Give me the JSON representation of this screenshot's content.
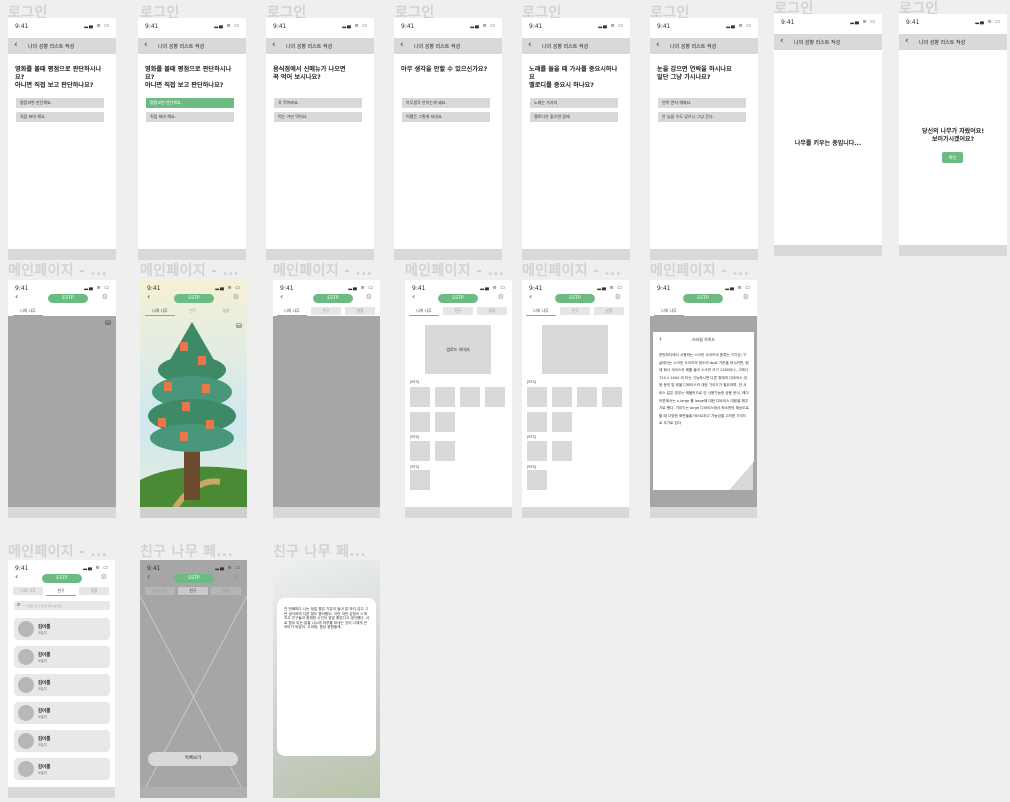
{
  "labels": {
    "login": "로그인",
    "main_page": "메인페이지 - ...",
    "friend_tree": "친구 나무 페..."
  },
  "status": {
    "time": "9:41",
    "icons": "▂▄ ≋ ▭"
  },
  "header": {
    "back": "‹",
    "title": "나의 성향 리스트 작성"
  },
  "questions": [
    {
      "q": "영화를 볼때 평점으로 판단하시나요?\n아니면 직접 보고 판단하나요?",
      "options": [
        "평점보면 판단해요.",
        "직접 봐야 해요."
      ],
      "selected": -1
    },
    {
      "q": "영화를 볼때 평점으로 판단하시나요?\n아니면 직접 보고 판단하나요?",
      "options": [
        "평점보면 판단해요.",
        "직접 봐야 해요."
      ],
      "selected": 0
    },
    {
      "q": "음식점에서 신메뉴가 나오면\n꼭 먹어 보시나요?",
      "options": [
        "꼭 먹어봐요.",
        "먹는 거만 먹어요."
      ],
      "selected": -1
    },
    {
      "q": "아무 생각을 안할 수 있으신가요?",
      "options": [
        "아무생각 안하는게 돼요.",
        "어쨌든 그렇게 되네요."
      ],
      "selected": -1
    },
    {
      "q": "노래를 들을 때 가사를 중요시하나요\n멜로디를 중요시 하나요?",
      "options": [
        "노래는 가사지",
        "멜로디가 좋으면 맘에"
      ],
      "selected": -1
    },
    {
      "q": "눈을 감으면 연락을 하시나요\n일단 그냥 가시나요?",
      "options": [
        "연락 먼저 해봐요.",
        "안 늦을 수도 있으니 그냥 간다."
      ],
      "selected": -1
    }
  ],
  "growing": {
    "message": "나무를 키우는 중입니다..."
  },
  "complete": {
    "message": "당신의 나무가 자랐어요!\n보러가시겠어요?",
    "button": "확인"
  },
  "main": {
    "badge": "ESTP",
    "chevron": "‹",
    "gear": "⚙",
    "tabs": [
      "나의 나무",
      "친구",
      "설정"
    ],
    "preview_label": "업로드 이미지",
    "section_label": "[RTS]",
    "doc_title": "스타일 가이드",
    "doc_text": "한번보다에서 사용하는 스크린 사이즈의 종류는 기기당, 구글에서는 스크린 사이즈의 정도의 dp로 기준을 하시려면, 현재 회사 서비스의 예를 들어 스크린 크기 1280이나, 그래서 720 x 1600 의 타는 기능하시면 다른 형태의 디바이스 대응 등의 맘 태블 디바이스의 대한 가이드가 필요하며, 전 서비스 같은 경우는 태블릿으로 안 사용가능한 공용 문서, 레이아웃에서는 x-large 를 large에 대한 디바이스 대응을 해주기로 했다. 가이드는 large 디바이스에서 최소한의 해상도로 할 때 다양한 화면들을 테스트하고 가능성을 고려한 가이드로 추가로 된다."
  },
  "friends": {
    "search_placeholder": "닉네임 친구 검색 하여 보세요",
    "list": [
      {
        "name": "김어룸",
        "status": "오늘치"
      },
      {
        "name": "김어룸",
        "status": "오늘치"
      },
      {
        "name": "김어룸",
        "status": "오늘치"
      },
      {
        "name": "김어룸",
        "status": "오늘치"
      },
      {
        "name": "김어룸",
        "status": "오늘치"
      },
      {
        "name": "김어룸",
        "status": "오늘치"
      }
    ]
  },
  "friend_view": {
    "button": "목록보기",
    "letter": "천 번째마다 나는 정말 좋은 기분이 들어 말 하지 않고 그런 생각하며 다른 점도 좋아했어. 이런 저런 감정이 느껴지고 친구들과 함께한 시간이 정말 좋았다고 생각했다. 서로 힘이 되는 말을 나누며 하루를 보내는 것이 나에게 큰 의미가 되었어. 고마워, 항상 응원할게."
  },
  "colors": {
    "accent": "#6bbb83",
    "grey": "#a6a6a6",
    "bar": "#d9d9d9"
  }
}
